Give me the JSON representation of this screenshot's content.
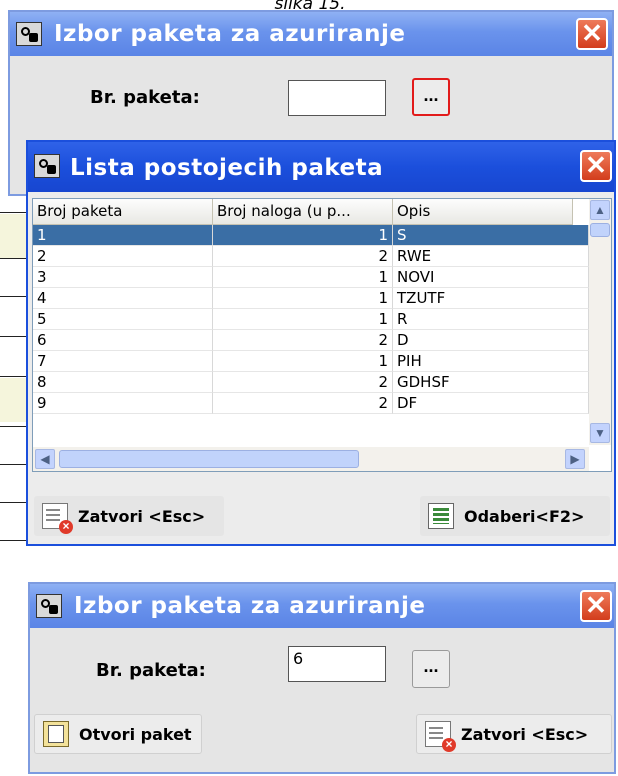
{
  "caption": "slika 15.",
  "dialog_top": {
    "title": "Izbor paketa za azuriranje",
    "label": "Br. paketa:",
    "value": "",
    "browse_label": "..."
  },
  "list_dialog": {
    "title": "Lista postojecih paketa",
    "columns": [
      "Broj paketa",
      "Broj naloga (u p...",
      "Opis"
    ],
    "rows": [
      {
        "broj": "1",
        "nalozi": "1",
        "opis": "S"
      },
      {
        "broj": "2",
        "nalozi": "2",
        "opis": "RWE"
      },
      {
        "broj": "3",
        "nalozi": "1",
        "opis": "NOVI"
      },
      {
        "broj": "4",
        "nalozi": "1",
        "opis": "TZUTF"
      },
      {
        "broj": "5",
        "nalozi": "1",
        "opis": "R"
      },
      {
        "broj": "6",
        "nalozi": "2",
        "opis": "D"
      },
      {
        "broj": "7",
        "nalozi": "1",
        "opis": "PIH"
      },
      {
        "broj": "8",
        "nalozi": "2",
        "opis": "GDHSF"
      },
      {
        "broj": "9",
        "nalozi": "2",
        "opis": "DF"
      }
    ],
    "selected_row": 0,
    "close_label": "Zatvori <Esc>",
    "select_label": "Odaberi<F2>"
  },
  "dialog_bottom": {
    "title": "Izbor paketa za azuriranje",
    "label": "Br. paketa:",
    "value": "6",
    "browse_label": "...",
    "open_label": "Otvori paket",
    "close_label": "Zatvori <Esc>"
  }
}
